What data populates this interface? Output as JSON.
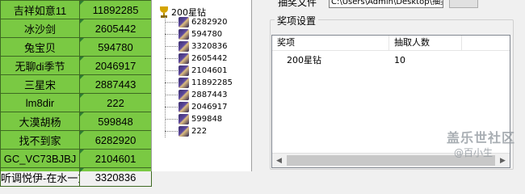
{
  "sheet": {
    "rows": [
      {
        "name": "吉祥如意11",
        "value": "11892285"
      },
      {
        "name": "冰沙剑",
        "value": "2605442"
      },
      {
        "name": "兔宝贝",
        "value": "594780"
      },
      {
        "name": "无聊di季节",
        "value": "2046917"
      },
      {
        "name": "三星宋",
        "value": "2887443"
      },
      {
        "name": "lm8dir",
        "value": "222"
      },
      {
        "name": "大漠胡杨",
        "value": "599848"
      },
      {
        "name": "找不到家",
        "value": "6282920"
      },
      {
        "name": "GC_VC73BJBJ",
        "value": "2104601"
      },
      {
        "name": "听调悦伊-在水一方",
        "value": "3320836"
      }
    ]
  },
  "tree": {
    "root_label": "200星钻",
    "children": [
      "6282920",
      "594780",
      "3320836",
      "2605442",
      "2104601",
      "11892285",
      "2887443",
      "2046917",
      "599848",
      "222"
    ]
  },
  "panel": {
    "file_label": "抽奖文件",
    "file_path": "C:\\Users\\Admin\\Desktop\\抽奖名单",
    "group_title": "奖项设置",
    "columns": [
      "奖项",
      "抽取人数"
    ],
    "rows": [
      {
        "prize": "200星钻",
        "count": "10"
      }
    ]
  },
  "watermark": {
    "line1": "盖乐世社区",
    "line2": "@百小生"
  }
}
